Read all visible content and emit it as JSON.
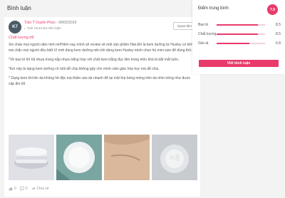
{
  "section_title": "Bình luận",
  "review": {
    "avatar_initials": "K7",
    "author_name": "Trần Ý Duyên Phan",
    "author_date": " - 06/02/2019",
    "user_meta": "Tuổi 19,24 Da nhìn hiện",
    "follow_label": "Quan tâm",
    "title": "Chất lượng tốt",
    "paragraphs": [
      "Xin chào mọi người năm mới nè!Hiếm nay mình sẽ review về một sản phẩm Hàn.Đó là kem dưỡng từ Huxley có tiếng mà chắc mọi người đều biết.Vì mới dùng kem dưỡng nên khi dùng kem Huxley mình chọn hủ mini size để dùng thử.",
      "*Về bao bì thì hũ nhựa trong nắp nhựa trắng hợp với chất kem trắng đục liền trong nhìn khá là bắt mắt luôn.",
      "*Em này là dạng kem dưỡng cô mũi dễ chịu không gây cho mình cảm giác hóa học mà dễ chịu.",
      "* Dạng kem khi lên da không hề đặc mà thấm vào da nhanh để lại một lớp bóng mỏng trên da nhìn trông như được cấp ẩm tốt"
    ],
    "more_photos_label": "+ 2",
    "action_likes": "0",
    "action_comments": "0",
    "action_share": "Chia sẻ"
  },
  "rating": {
    "title": "Điểm trung bình",
    "overall": "7.9",
    "rows": [
      {
        "label": "Bao bì",
        "score": "8.5",
        "fraction": 0.85
      },
      {
        "label": "Chất lượng",
        "score": "8.5",
        "fraction": 0.85
      },
      {
        "label": "Giá cả",
        "score": "6.8",
        "fraction": 0.68
      }
    ],
    "write_button": "Viết bình luận"
  },
  "colors": {
    "accent": "#e83a6b",
    "avatar_bg": "#4b5a66"
  },
  "icons": [
    "like-icon",
    "comment-icon",
    "share-icon"
  ]
}
